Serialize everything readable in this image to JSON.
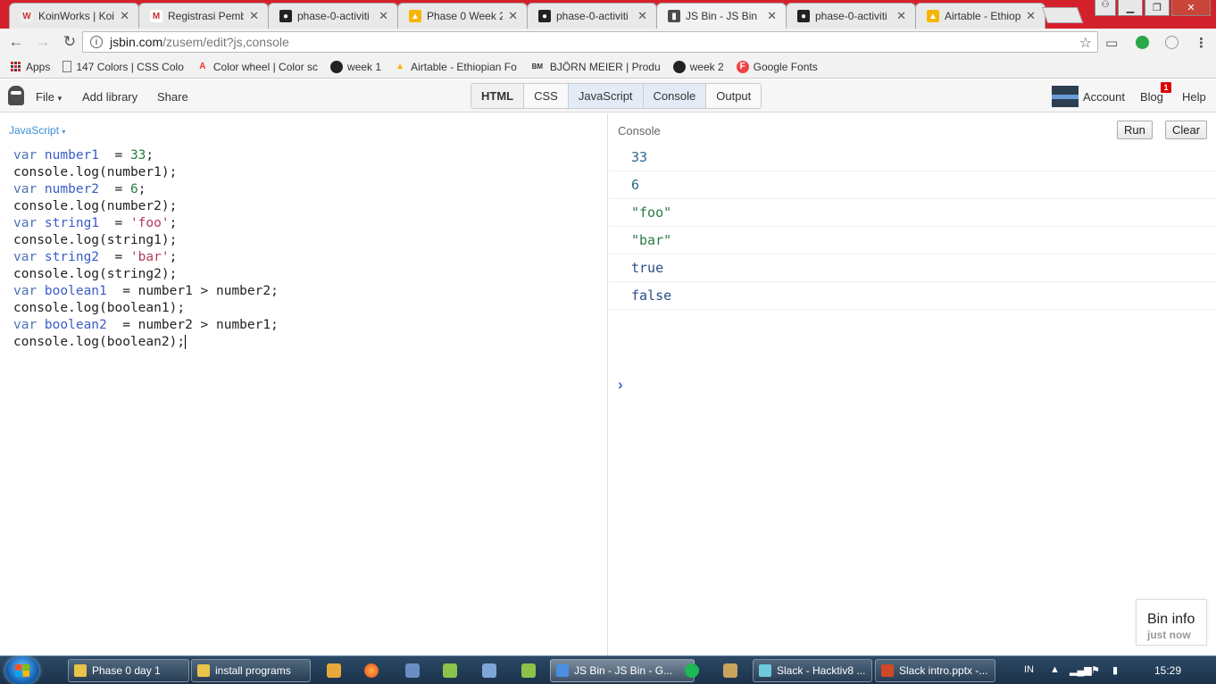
{
  "browser": {
    "tabs": [
      {
        "title": "KoinWorks | Koi",
        "icon": "koinworks-icon",
        "color": "#f0f0f0",
        "glyph": "W"
      },
      {
        "title": "Registrasi Pemb",
        "icon": "gmail-icon",
        "color": "#ffffff",
        "glyph": "M"
      },
      {
        "title": "phase-0-activiti",
        "icon": "github-icon",
        "color": "#222222",
        "glyph": "●"
      },
      {
        "title": "Phase 0 Week 2",
        "icon": "airtable-icon",
        "color": "#f7b500",
        "glyph": "▲"
      },
      {
        "title": "phase-0-activiti",
        "icon": "github-icon",
        "color": "#222222",
        "glyph": "●"
      },
      {
        "title": "JS Bin - JS Bin",
        "icon": "jsbin-icon",
        "color": "#4d4d4d",
        "glyph": "▮"
      },
      {
        "title": "phase-0-activiti",
        "icon": "github-icon",
        "color": "#222222",
        "glyph": "●"
      },
      {
        "title": "Airtable - Ethiop",
        "icon": "airtable-icon",
        "color": "#f7b500",
        "glyph": "▲"
      }
    ],
    "active_tab": 5,
    "url_host": "jsbin.com",
    "url_path": "/zusem/edit?js,console",
    "bookmarks": [
      {
        "label": "Apps",
        "icon": "apps-grid-icon"
      },
      {
        "label": "147 Colors | CSS Colo",
        "icon": "page-icon"
      },
      {
        "label": "Color wheel | Color sc",
        "icon": "adobe-icon"
      },
      {
        "label": "week 1",
        "icon": "github-icon"
      },
      {
        "label": "Airtable - Ethiopian Fo",
        "icon": "airtable-icon"
      },
      {
        "label": "BJÖRN MEIER | Produ",
        "icon": "bm-icon"
      },
      {
        "label": "week 2",
        "icon": "github-icon"
      },
      {
        "label": "Google Fonts",
        "icon": "google-fonts-icon"
      }
    ]
  },
  "jsbin": {
    "menu": {
      "file": "File",
      "add_library": "Add library",
      "share": "Share"
    },
    "panels": [
      "HTML",
      "CSS",
      "JavaScript",
      "Console",
      "Output"
    ],
    "right": {
      "account": "Account",
      "blog": "Blog",
      "blog_badge": "1",
      "help": "Help"
    },
    "editor_label": "JavaScript",
    "code": [
      [
        [
          "kw",
          "var "
        ],
        [
          "vn",
          "number1"
        ],
        [
          "",
          "  = "
        ],
        [
          "num",
          "33"
        ],
        [
          "",
          ";"
        ]
      ],
      [
        [
          "",
          "console.log(number1);"
        ]
      ],
      [
        [
          "kw",
          "var "
        ],
        [
          "vn",
          "number2"
        ],
        [
          "",
          "  = "
        ],
        [
          "num",
          "6"
        ],
        [
          "",
          ";"
        ]
      ],
      [
        [
          "",
          "console.log(number2);"
        ]
      ],
      [
        [
          "kw",
          "var "
        ],
        [
          "vn",
          "string1"
        ],
        [
          "",
          "  = "
        ],
        [
          "str",
          "'foo'"
        ],
        [
          "",
          ";"
        ]
      ],
      [
        [
          "",
          "console.log(string1);"
        ]
      ],
      [
        [
          "kw",
          "var "
        ],
        [
          "vn",
          "string2"
        ],
        [
          "",
          "  = "
        ],
        [
          "str",
          "'bar'"
        ],
        [
          "",
          ";"
        ]
      ],
      [
        [
          "",
          "console.log(string2);"
        ]
      ],
      [
        [
          "kw",
          "var "
        ],
        [
          "vn",
          "boolean1"
        ],
        [
          "",
          "  = number1 > number2;"
        ]
      ],
      [
        [
          "",
          "console.log(boolean1);"
        ]
      ],
      [
        [
          "kw",
          "var "
        ],
        [
          "vn",
          "boolean2"
        ],
        [
          "",
          "  = number2 > number1;"
        ]
      ],
      [
        [
          "",
          "console.log(boolean2);"
        ]
      ]
    ],
    "console_label": "Console",
    "run_label": "Run",
    "clear_label": "Clear",
    "output": [
      {
        "text": "33",
        "kind": "n"
      },
      {
        "text": "6",
        "kind": "n"
      },
      {
        "text": "\"foo\"",
        "kind": "s"
      },
      {
        "text": "\"bar\"",
        "kind": "s"
      },
      {
        "text": "true",
        "kind": "b"
      },
      {
        "text": "false",
        "kind": "b"
      }
    ],
    "prompt": "›",
    "bin_info": {
      "title": "Bin info",
      "time": "just now"
    }
  },
  "taskbar": {
    "items": [
      {
        "label": "Phase 0 day 1",
        "color": "#e9c44a",
        "active": false
      },
      {
        "label": "install programs",
        "color": "#e9c44a",
        "active": false
      },
      {
        "label": "JS Bin - JS Bin - G...",
        "color": "#4a8fe0",
        "active": true
      },
      {
        "label": "Slack - Hacktiv8 ...",
        "color": "#6ecadc",
        "active": false
      },
      {
        "label": "Slack intro.pptx -...",
        "color": "#d24726",
        "active": false
      }
    ],
    "lang": "IN",
    "clock": "15:29"
  }
}
